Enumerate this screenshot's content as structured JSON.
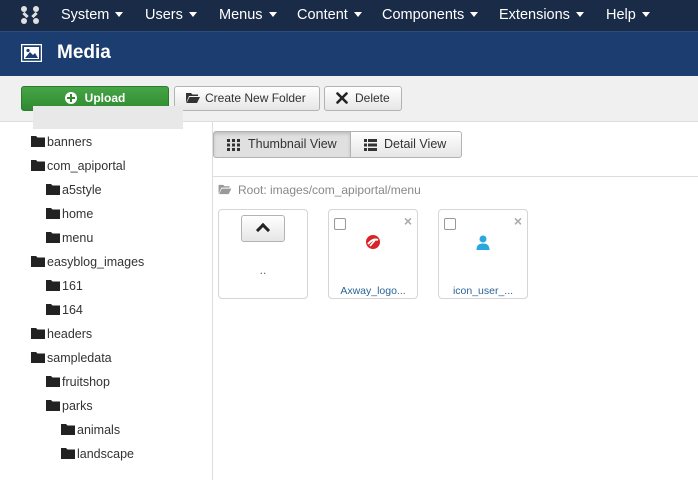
{
  "nav": {
    "items": [
      {
        "label": "System"
      },
      {
        "label": "Users"
      },
      {
        "label": "Menus"
      },
      {
        "label": "Content"
      },
      {
        "label": "Components"
      },
      {
        "label": "Extensions"
      },
      {
        "label": "Help"
      }
    ]
  },
  "header": {
    "title": "Media"
  },
  "toolbar": {
    "upload_label": "Upload",
    "new_folder_label": "Create New Folder",
    "delete_label": "Delete"
  },
  "tree": {
    "items": [
      {
        "label": "banners",
        "level": 0
      },
      {
        "label": "com_apiportal",
        "level": 0
      },
      {
        "label": "a5style",
        "level": 1
      },
      {
        "label": "home",
        "level": 1
      },
      {
        "label": "menu",
        "level": 1,
        "selected": true
      },
      {
        "label": "easyblog_images",
        "level": 0
      },
      {
        "label": "161",
        "level": 1
      },
      {
        "label": "164",
        "level": 1
      },
      {
        "label": "headers",
        "level": 0
      },
      {
        "label": "sampledata",
        "level": 0
      },
      {
        "label": "fruitshop",
        "level": 1
      },
      {
        "label": "parks",
        "level": 1
      },
      {
        "label": "animals",
        "level": 2
      },
      {
        "label": "landscape",
        "level": 2
      }
    ]
  },
  "view": {
    "thumbnail_label": "Thumbnail View",
    "detail_label": "Detail View"
  },
  "breadcrumb": {
    "text": "Root: images/com_apiportal/menu"
  },
  "files": {
    "up_label": "..",
    "items": [
      {
        "name": "Axway_logo...",
        "icon": "axway-logo-icon"
      },
      {
        "name": "icon_user_...",
        "icon": "user-icon"
      }
    ]
  },
  "colors": {
    "navbar": "#1a2b47",
    "titlebar": "#1c3d70",
    "upload_green": "#46a546",
    "link": "#2a6496"
  }
}
